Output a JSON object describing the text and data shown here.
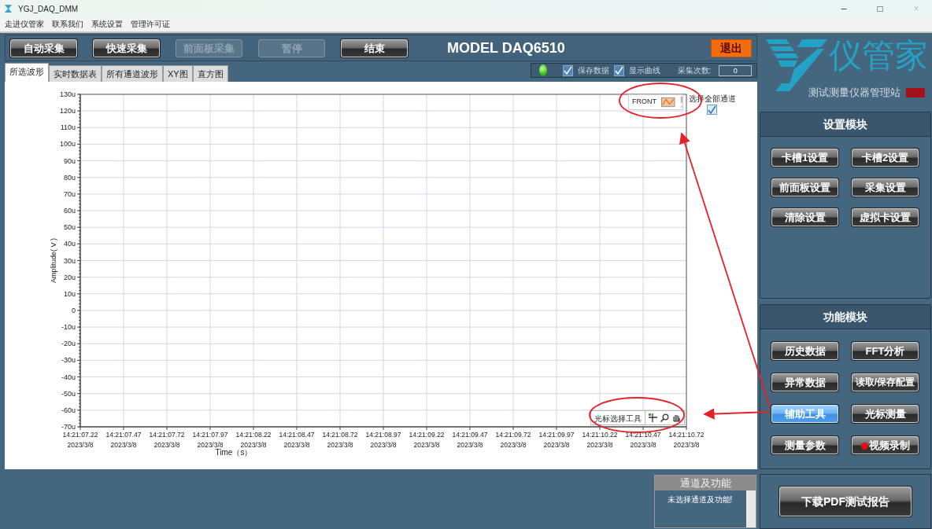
{
  "window": {
    "title": "YGJ_DAQ_DMM",
    "controls": [
      "–",
      "□",
      "×"
    ]
  },
  "menu": [
    "走进仪管家",
    "联系我们",
    "系统设置",
    "管理许可证"
  ],
  "toolbar": {
    "buttons": [
      {
        "label": "自动采集",
        "disabled": false
      },
      {
        "label": "快速采集",
        "disabled": false
      },
      {
        "label": "前面板采集",
        "disabled": true
      },
      {
        "label": "暂停",
        "disabled": true
      },
      {
        "label": "结束",
        "disabled": false
      }
    ],
    "model": "MODEL DAQ6510",
    "exit_button": "退出"
  },
  "tabs": [
    {
      "label": "所选波形",
      "selected": true
    },
    {
      "label": "实时数据表",
      "selected": false
    },
    {
      "label": "所有通道波形",
      "selected": false
    },
    {
      "label": "XY图",
      "selected": false
    },
    {
      "label": "直方图",
      "selected": false
    }
  ],
  "status": {
    "led_on": true,
    "checkboxes": [
      {
        "label": "保存数据",
        "checked": true
      },
      {
        "label": "显示曲线",
        "checked": true
      }
    ],
    "count_label": "采集次数:",
    "count_value": "0"
  },
  "chart": {
    "legend": "FRONT",
    "select_all": {
      "label": "选择全部通道",
      "checked": true
    },
    "cursor_tool": "光标选择工具",
    "chart_data": {
      "type": "line",
      "grid": true,
      "xlabel": "Time（s）",
      "ylabel": "Amplitude( V )",
      "ylim": [
        -70,
        130
      ],
      "yticks": [
        {
          "value": 130,
          "label": "130u"
        },
        {
          "value": 120,
          "label": "120u"
        },
        {
          "value": 110,
          "label": "110u"
        },
        {
          "value": 100,
          "label": "100u"
        },
        {
          "value": 90,
          "label": "90u"
        },
        {
          "value": 80,
          "label": "80u"
        },
        {
          "value": 70,
          "label": "70u"
        },
        {
          "value": 60,
          "label": "60u"
        },
        {
          "value": 50,
          "label": "50u"
        },
        {
          "value": 40,
          "label": "40u"
        },
        {
          "value": 30,
          "label": "30u"
        },
        {
          "value": 20,
          "label": "20u"
        },
        {
          "value": 10,
          "label": "10u"
        },
        {
          "value": 0,
          "label": "0"
        },
        {
          "value": -10,
          "label": "-10u"
        },
        {
          "value": -20,
          "label": "-20u"
        },
        {
          "value": -30,
          "label": "-30u"
        },
        {
          "value": -40,
          "label": "-40u"
        },
        {
          "value": -50,
          "label": "-50u"
        },
        {
          "value": -60,
          "label": "-60u"
        },
        {
          "value": -70,
          "label": "-70u"
        }
      ],
      "categories": [
        "14:21:07.22 2023/3/8",
        "14:21:07.47 2023/3/8",
        "14:21:07.72 2023/3/8",
        "14:21:07.97 2023/3/8",
        "14:21:08.22 2023/3/8",
        "14:21:08.47 2023/3/8",
        "14:21:08.72 2023/3/8",
        "14:21:08.97 2023/3/8",
        "14:21:09.22 2023/3/8",
        "14:21:09.47 2023/3/8",
        "14:21:09.72 2023/3/8",
        "14:21:09.97 2023/3/8",
        "14:21:10.22 2023/3/8",
        "14:21:10.47 2023/3/8",
        "14:21:10.72 2023/3/8"
      ]
    }
  },
  "channel_panel": {
    "title": "通道及功能",
    "message": "未选择通道及功能!"
  },
  "logo": {
    "name": "仪管家",
    "subtitle": "测试测量仪器管理站"
  },
  "settings_module": {
    "title": "设置模块",
    "buttons": [
      {
        "label": "卡槽1设置",
        "selected": false
      },
      {
        "label": "卡槽2设置",
        "selected": false
      },
      {
        "label": "前面板设置",
        "selected": false
      },
      {
        "label": "采集设置",
        "selected": false
      },
      {
        "label": "清除设置",
        "selected": false
      },
      {
        "label": "虚拟卡设置",
        "selected": false
      }
    ]
  },
  "function_module": {
    "title": "功能模块",
    "buttons": [
      {
        "label": "历史数据",
        "selected": false,
        "recording": false
      },
      {
        "label": "FFT分析",
        "selected": false,
        "recording": false
      },
      {
        "label": "异常数据",
        "selected": false,
        "recording": false
      },
      {
        "label": "读取/保存配置",
        "selected": false,
        "recording": false
      },
      {
        "label": "辅助工具",
        "selected": true,
        "recording": false
      },
      {
        "label": "光标测量",
        "selected": false,
        "recording": false
      },
      {
        "label": "测量参数",
        "selected": false,
        "recording": false
      },
      {
        "label": "视频录制",
        "selected": false,
        "recording": true
      }
    ]
  },
  "report_button": "下载PDF测试报告",
  "annotations": [
    {
      "kind": "ellipse"
    },
    {
      "kind": "ellipse"
    },
    {
      "kind": "arrow"
    },
    {
      "kind": "arrow"
    }
  ]
}
